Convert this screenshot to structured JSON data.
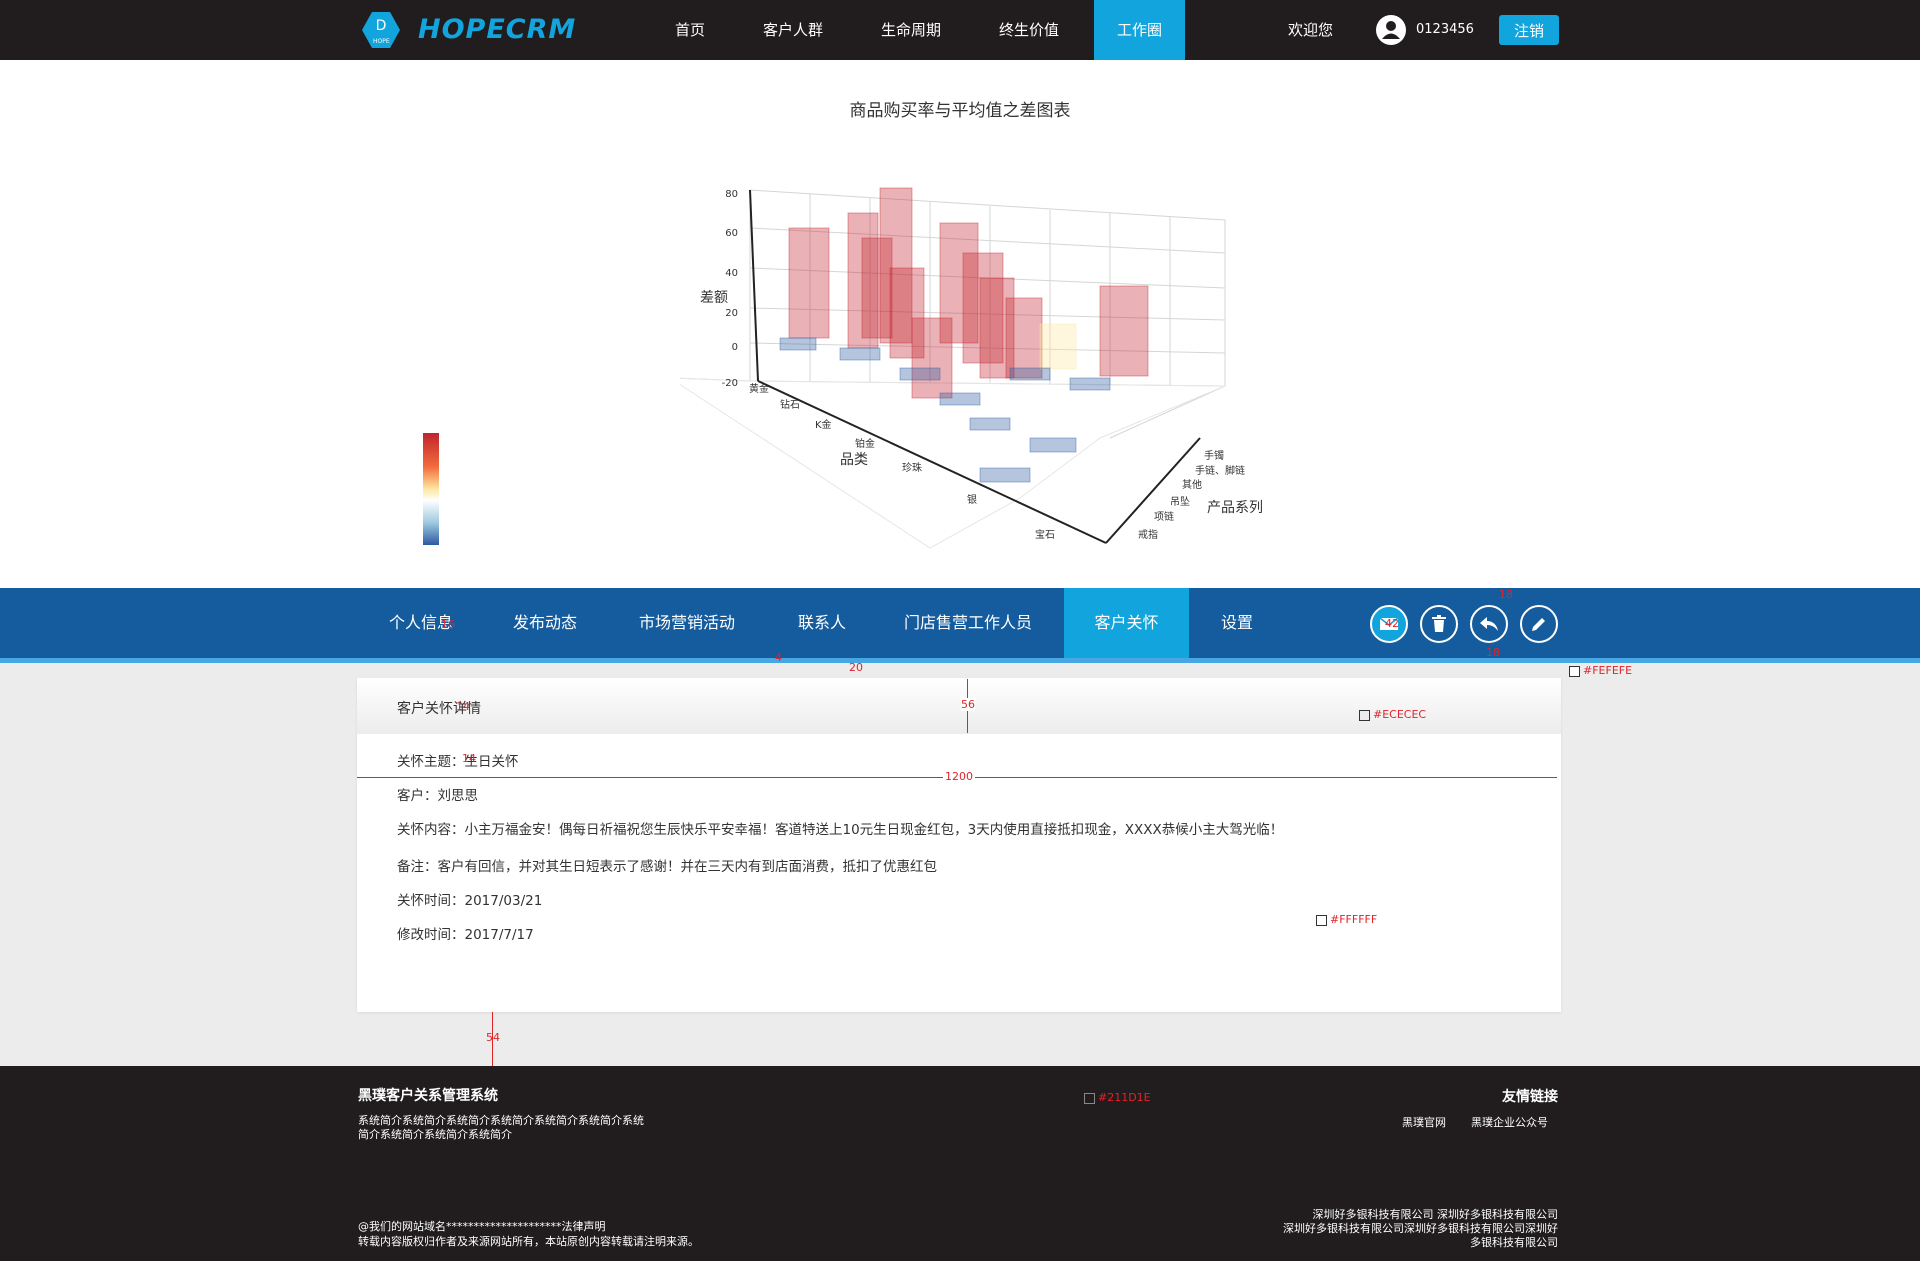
{
  "app": {
    "logo_text": "HOPECRM",
    "logo_small": "HOPE"
  },
  "nav": {
    "items": [
      {
        "label": "首页"
      },
      {
        "label": "客户人群"
      },
      {
        "label": "生命周期"
      },
      {
        "label": "终生价值"
      },
      {
        "label": "工作圈",
        "active": true
      }
    ],
    "welcome": "欢迎您",
    "username": "0123456",
    "logout": "注销"
  },
  "chart_data": {
    "type": "bar",
    "title": "商品购买率与平均值之差图表",
    "zlabel": "差额",
    "xlabel": "品类",
    "ylabel": "产品系列",
    "z_ticks": [
      "80",
      "60",
      "40",
      "20",
      "0",
      "-20"
    ],
    "categories": [
      "黄金",
      "钻石",
      "K金",
      "铂金",
      "珍珠",
      "银",
      "宝石"
    ],
    "series_labels": [
      "手镯",
      "手链、脚链",
      "其他",
      "吊坠",
      "项链",
      "戒指"
    ],
    "zlim": [
      -20,
      80
    ],
    "colorscale": [
      "#c2232e",
      "#f26b3c",
      "#fde7a0",
      "#ffffff",
      "#9ecae1",
      "#2c5aa0"
    ]
  },
  "tabs": {
    "items": [
      {
        "label": "个人信息"
      },
      {
        "label": "发布动态"
      },
      {
        "label": "市场营销活动"
      },
      {
        "label": "联系人"
      },
      {
        "label": "门店售营工作人员"
      },
      {
        "label": "客户关怀",
        "active": true
      },
      {
        "label": "设置"
      }
    ],
    "mail_badge": "42"
  },
  "card": {
    "title": "客户关怀详情",
    "rows": [
      {
        "label": "关怀主题：",
        "value": "生日关怀"
      },
      {
        "label": "客户：",
        "value": "刘思思"
      },
      {
        "label": "关怀内容：",
        "value": "小主万福金安！偶每日祈福祝您生辰快乐平安幸福！客道特送上10元生日现金红包，3天内使用直接抵扣现金，XXXX恭候小主大驾光临！"
      },
      {
        "label": "备注：",
        "value": "客户有回信，并对其生日短表示了感谢！并在三天内有到店面消费，抵扣了优惠红包"
      },
      {
        "label": "关怀时间：",
        "value": "2017/03/21"
      },
      {
        "label": "修改时间：",
        "value": "2017/7/17"
      }
    ]
  },
  "annotations": {
    "width_1200": "1200",
    "gap_56": "56",
    "gap_54": "54",
    "gap_20": "20",
    "gap_18a": "18",
    "gap_18b": "18",
    "gap_4": "4",
    "size_16": "16",
    "size_14a": "14",
    "size_14b": "14",
    "color_fefefe": "#FEFEFE",
    "color_ececec": "#ECECEC",
    "color_ffffff": "#FFFFFF",
    "color_211d1e": "#211D1E"
  },
  "footer": {
    "title": "黑璞客户关系管理系统",
    "intro_1": "系统简介系统简介系统简介系统简介系统简介系统简介系统",
    "intro_2": "简介系统简介系统简介系统简介",
    "links_title": "友情链接",
    "link_1": "黑璞官网",
    "link_2": "黑璞企业公众号",
    "legal_1": "@我们的网站域名*********************法律声明",
    "legal_2": "转载内容版权归作者及来源网站所有，本站原创内容转载请注明来源。",
    "company_1": "深圳好多银科技有限公司 深圳好多银科技有限公司",
    "company_2": "深圳好多银科技有限公司深圳好多银科技有限公司深圳好",
    "company_3": "多银科技有限公司"
  }
}
